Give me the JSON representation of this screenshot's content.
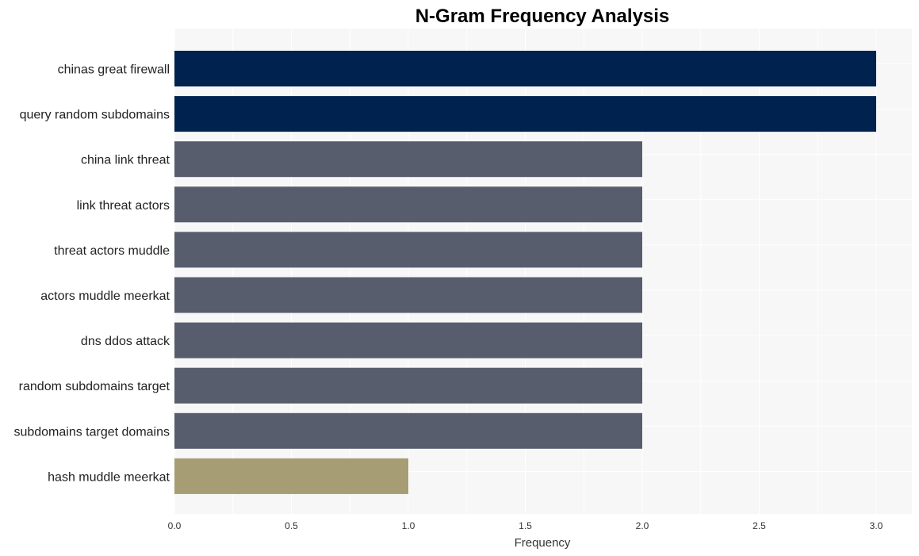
{
  "chart_data": {
    "type": "bar",
    "orientation": "horizontal",
    "title": "N-Gram Frequency Analysis",
    "xlabel": "Frequency",
    "ylabel": "",
    "xlim": [
      0,
      3.15
    ],
    "xticks": [
      0.0,
      0.5,
      1.0,
      1.5,
      2.0,
      2.5,
      3.0
    ],
    "xtick_labels": [
      "0.0",
      "0.5",
      "1.0",
      "1.5",
      "2.0",
      "2.5",
      "3.0"
    ],
    "grid": true,
    "categories": [
      "chinas great firewall",
      "query random subdomains",
      "china link threat",
      "link threat actors",
      "threat actors muddle",
      "actors muddle meerkat",
      "dns ddos attack",
      "random subdomains target",
      "subdomains target domains",
      "hash muddle meerkat"
    ],
    "values": [
      3,
      3,
      2,
      2,
      2,
      2,
      2,
      2,
      2,
      1
    ],
    "colors": [
      "#00224e",
      "#00224e",
      "#575d6d",
      "#575d6d",
      "#575d6d",
      "#575d6d",
      "#575d6d",
      "#575d6d",
      "#575d6d",
      "#a69d75"
    ]
  }
}
